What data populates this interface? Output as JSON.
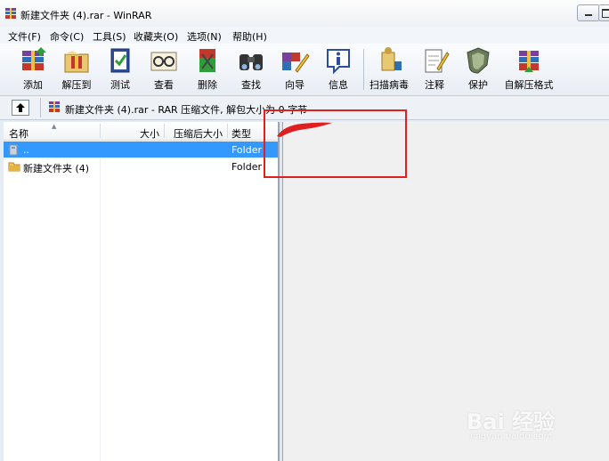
{
  "window": {
    "title": "新建文件夹 (4).rar - WinRAR"
  },
  "menu": [
    "文件(F)",
    "命令(C)",
    "工具(S)",
    "收藏夹(O)",
    "选项(N)",
    "帮助(H)"
  ],
  "toolbar": [
    {
      "label": "添加",
      "icon": "add-archive-icon"
    },
    {
      "label": "解压到",
      "icon": "extract-to-icon"
    },
    {
      "label": "测试",
      "icon": "test-icon"
    },
    {
      "label": "查看",
      "icon": "view-icon"
    },
    {
      "label": "删除",
      "icon": "delete-icon"
    },
    {
      "label": "查找",
      "icon": "find-icon"
    },
    {
      "label": "向导",
      "icon": "wizard-icon"
    },
    {
      "label": "信息",
      "icon": "info-icon"
    },
    {
      "label": "扫描病毒",
      "icon": "virus-scan-icon"
    },
    {
      "label": "注释",
      "icon": "comment-icon"
    },
    {
      "label": "保护",
      "icon": "protect-icon"
    },
    {
      "label": "自解压格式",
      "icon": "sfx-icon"
    }
  ],
  "address": {
    "text": "新建文件夹 (4).rar - RAR 压缩文件, 解包大小为 0 字节"
  },
  "columns": {
    "name": "名称",
    "size": "大小",
    "packed": "压缩后大小",
    "type": "类型"
  },
  "files": [
    {
      "name": "..",
      "type": "Folder",
      "selected": true
    },
    {
      "name": "新建文件夹 (4)",
      "type": "Folder",
      "selected": false
    }
  ],
  "watermark": {
    "main": "Bai 经验",
    "sub": "jingyan.baidu.com"
  },
  "colors": {
    "selection": "#3399ff",
    "annotation": "#e02020"
  }
}
